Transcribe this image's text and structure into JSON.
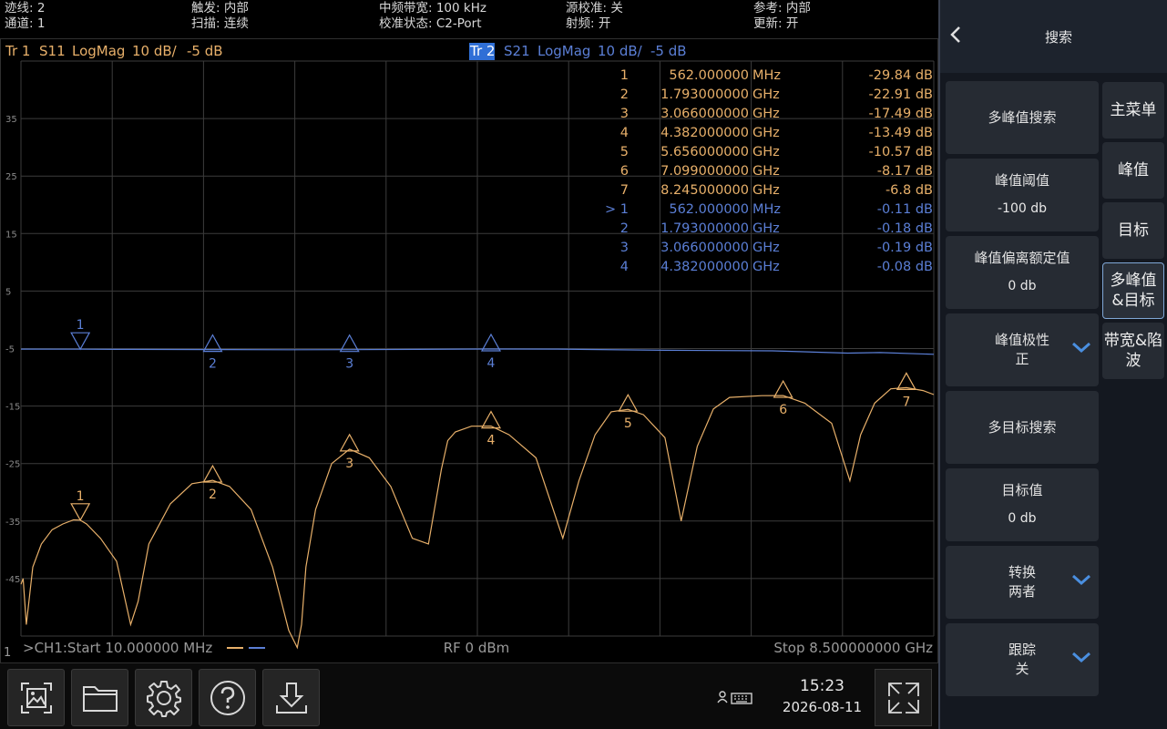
{
  "status": {
    "trace_count": "迹线: 2",
    "channel": "通道: 1",
    "trigger": "触发: 内部",
    "sweep": "扫描: 连续",
    "if_bw": "中频带宽: 100 kHz",
    "cal_state": "校准状态: C2-Port",
    "source_cal": "源校准: 关",
    "rf": "射频: 开",
    "reference": "参考: 内部",
    "update": "更新: 开"
  },
  "traces": {
    "tr1": {
      "id": "Tr 1",
      "param": "S11",
      "format": "LogMag",
      "scale": "10 dB/",
      "ref": "-5 dB"
    },
    "tr2": {
      "id": "Tr 2",
      "param": "S21",
      "format": "LogMag",
      "scale": "10 dB/",
      "ref": "-5 dB"
    }
  },
  "y_ticks": [
    "35",
    "25",
    "15",
    "5",
    "-5",
    "-15",
    "-25",
    "-35",
    "-45"
  ],
  "markers_tr1": [
    {
      "n": "1",
      "freq": "562.000000",
      "unit": "MHz",
      "val": "-29.84 dB"
    },
    {
      "n": "2",
      "freq": "1.793000000",
      "unit": "GHz",
      "val": "-22.91 dB"
    },
    {
      "n": "3",
      "freq": "3.066000000",
      "unit": "GHz",
      "val": "-17.49 dB"
    },
    {
      "n": "4",
      "freq": "4.382000000",
      "unit": "GHz",
      "val": "-13.49 dB"
    },
    {
      "n": "5",
      "freq": "5.656000000",
      "unit": "GHz",
      "val": "-10.57 dB"
    },
    {
      "n": "6",
      "freq": "7.099000000",
      "unit": "GHz",
      "val": "-8.17 dB"
    },
    {
      "n": "7",
      "freq": "8.245000000",
      "unit": "GHz",
      "val": "-6.8 dB"
    }
  ],
  "markers_tr2": [
    {
      "n": "> 1",
      "freq": "562.000000",
      "unit": "MHz",
      "val": "-0.11 dB"
    },
    {
      "n": "2",
      "freq": "1.793000000",
      "unit": "GHz",
      "val": "-0.18 dB"
    },
    {
      "n": "3",
      "freq": "3.066000000",
      "unit": "GHz",
      "val": "-0.19 dB"
    },
    {
      "n": "4",
      "freq": "4.382000000",
      "unit": "GHz",
      "val": "-0.08 dB"
    }
  ],
  "footer": {
    "bottom_index": "1",
    "start": ">CH1:Start 10.000000 MHz",
    "power": "RF 0 dBm",
    "stop": "Stop 8.500000000 GHz"
  },
  "clock": {
    "time": "15:23",
    "date": "2026-08-11"
  },
  "panel": {
    "title": "搜索",
    "buttons": [
      {
        "label": "多峰值搜索",
        "sub": ""
      },
      {
        "label": "峰值阈值",
        "sub": "-100 db"
      },
      {
        "label": "峰值偏离额定值",
        "sub": "0 db"
      },
      {
        "label": "峰值极性",
        "sub": "正"
      },
      {
        "label": "多目标搜索",
        "sub": ""
      },
      {
        "label": "目标值",
        "sub": "0 db"
      },
      {
        "label": "转换",
        "sub": "两者"
      },
      {
        "label": "跟踪",
        "sub": "关"
      }
    ],
    "tabs": [
      "主菜单",
      "峰值",
      "目标",
      "多峰值\n&目标",
      "带宽&陷\n波"
    ]
  },
  "colors": {
    "tr1": "#e8b06a",
    "tr2": "#5b7fd6",
    "grid": "#3c3c3c",
    "panel_bg": "#141820",
    "button_bg": "#262b33",
    "active_border": "#7fa7d6"
  },
  "chart_data": [
    {
      "type": "line",
      "title": "",
      "xlabel": "",
      "ylabel": "",
      "x_unit": "GHz",
      "xlim": [
        0.01,
        8.5
      ],
      "ylim": [
        -50,
        50
      ],
      "series": [
        {
          "name": "S11",
          "x": [
            0.01,
            0.03,
            0.06,
            0.12,
            0.2,
            0.3,
            0.4,
            0.5,
            0.562,
            0.62,
            0.75,
            0.9,
            1.03,
            1.1,
            1.2,
            1.4,
            1.6,
            1.793,
            1.95,
            2.15,
            2.35,
            2.5,
            2.58,
            2.62,
            2.66,
            2.75,
            2.9,
            3.066,
            3.25,
            3.45,
            3.65,
            3.8,
            3.92,
            3.98,
            4.05,
            4.2,
            4.382,
            4.55,
            4.8,
            5.05,
            5.2,
            5.35,
            5.5,
            5.656,
            5.8,
            6.0,
            6.15,
            6.3,
            6.45,
            6.6,
            6.9,
            7.099,
            7.3,
            7.55,
            7.72,
            7.82,
            7.95,
            8.1,
            8.245,
            8.4,
            8.5
          ],
          "y": [
            -41,
            -40,
            -48,
            -38,
            -34,
            -31.5,
            -30.5,
            -29.8,
            -29.84,
            -30.5,
            -33,
            -37,
            -48,
            -44,
            -34,
            -27,
            -23.5,
            -22.91,
            -24,
            -28,
            -38,
            -49,
            -52,
            -48,
            -38,
            -28,
            -20,
            -17.49,
            -19,
            -24,
            -33,
            -34,
            -21,
            -16,
            -14.5,
            -13.5,
            -13.49,
            -15,
            -19,
            -33,
            -23,
            -15,
            -11,
            -10.57,
            -11.5,
            -15.5,
            -30,
            -17,
            -10.5,
            -8.5,
            -8.2,
            -8.17,
            -9.5,
            -13,
            -23,
            -15,
            -9.5,
            -7,
            -6.8,
            -7.3,
            -8
          ]
        },
        {
          "name": "S21",
          "x": [
            0.01,
            0.562,
            1.0,
            1.793,
            2.5,
            3.066,
            3.7,
            4.382,
            5.0,
            6.0,
            7.0,
            7.7,
            8.0,
            8.5
          ],
          "y": [
            -0.1,
            -0.11,
            -0.15,
            -0.18,
            -0.2,
            -0.19,
            -0.15,
            -0.08,
            -0.1,
            -0.3,
            -0.4,
            -0.8,
            -0.7,
            -1.0
          ]
        }
      ],
      "markers_tr1": [
        0.562,
        1.793,
        3.066,
        4.382,
        5.656,
        7.099,
        8.245
      ],
      "markers_tr2": [
        0.562,
        1.793,
        3.066,
        4.382
      ]
    }
  ]
}
